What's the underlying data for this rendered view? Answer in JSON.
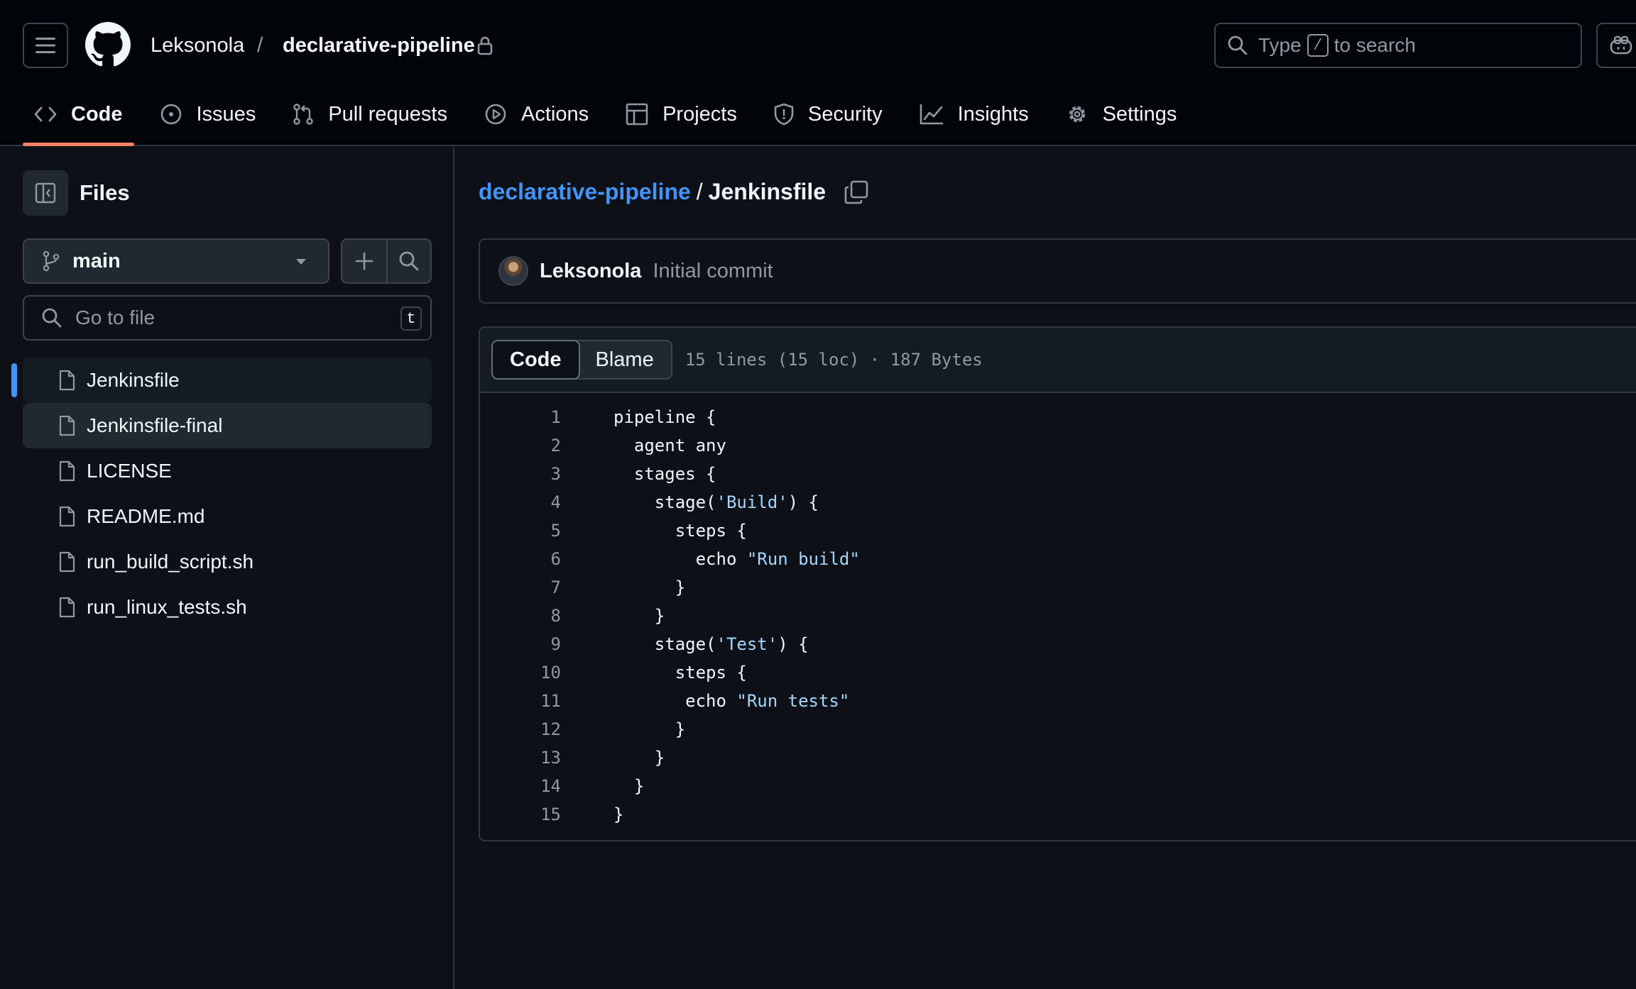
{
  "header": {
    "owner": "Leksonola",
    "separator": "/",
    "repo": "declarative-pipeline",
    "search": {
      "prefix": "Type",
      "key": "/",
      "suffix": "to search"
    }
  },
  "nav_tabs": [
    {
      "label": "Code",
      "icon": "code-icon",
      "active": true
    },
    {
      "label": "Issues",
      "icon": "issue-opened-icon"
    },
    {
      "label": "Pull requests",
      "icon": "git-pull-request-icon"
    },
    {
      "label": "Actions",
      "icon": "play-icon"
    },
    {
      "label": "Projects",
      "icon": "table-icon"
    },
    {
      "label": "Security",
      "icon": "shield-icon"
    },
    {
      "label": "Insights",
      "icon": "graph-icon"
    },
    {
      "label": "Settings",
      "icon": "gear-icon"
    }
  ],
  "sidebar": {
    "title": "Files",
    "branch": "main",
    "goto_placeholder": "Go to file",
    "goto_shortcut": "t",
    "files": [
      {
        "name": "Jenkinsfile",
        "selected": true
      },
      {
        "name": "Jenkinsfile-final",
        "hover": true
      },
      {
        "name": "LICENSE"
      },
      {
        "name": "README.md"
      },
      {
        "name": "run_build_script.sh"
      },
      {
        "name": "run_linux_tests.sh"
      }
    ]
  },
  "main": {
    "breadcrumb": {
      "repo": "declarative-pipeline",
      "separator": "/",
      "file": "Jenkinsfile"
    },
    "commit": {
      "author": "Leksonola",
      "message": "Initial commit"
    },
    "view_tabs": {
      "code": "Code",
      "blame": "Blame"
    },
    "file_meta": "15 lines (15 loc) · 187 Bytes",
    "code_lines": [
      "pipeline {",
      "  agent any",
      "  stages {",
      "    stage('Build') {",
      "      steps {",
      "        echo \"Run build\"",
      "      }",
      "    }",
      "    stage('Test') {",
      "      steps {",
      "       echo \"Run tests\"",
      "      }",
      "    }",
      "  }",
      "}"
    ]
  },
  "colors": {
    "background": "#0d1117",
    "header_bg": "#010409",
    "accent_link": "#4493f8",
    "active_tab_underline": "#f78166",
    "string": "#a5d6ff",
    "muted_text": "#9198a1"
  }
}
